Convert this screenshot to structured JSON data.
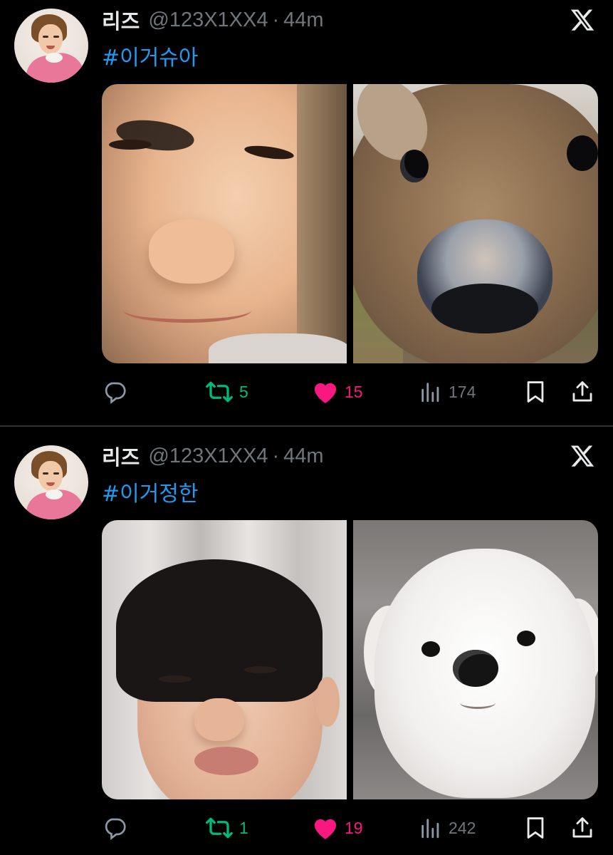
{
  "tweets": [
    {
      "author_name": "리즈",
      "author_handle": "@123X1XX4",
      "separator": "·",
      "time": "44m",
      "text": "#이거슈아",
      "retweets": "5",
      "likes": "15",
      "views": "174"
    },
    {
      "author_name": "리즈",
      "author_handle": "@123X1XX4",
      "separator": "·",
      "time": "44m",
      "text": "#이거정한",
      "retweets": "1",
      "likes": "19",
      "views": "242"
    }
  ],
  "colors": {
    "background": "#000000",
    "hashtag": "#1d9bf0",
    "retweet": "#00ba7c",
    "like": "#f91880",
    "muted": "#71767b"
  },
  "icons": [
    "x-logo-icon",
    "reply-icon",
    "retweet-icon",
    "heart-icon",
    "views-icon",
    "bookmark-icon",
    "share-icon"
  ]
}
